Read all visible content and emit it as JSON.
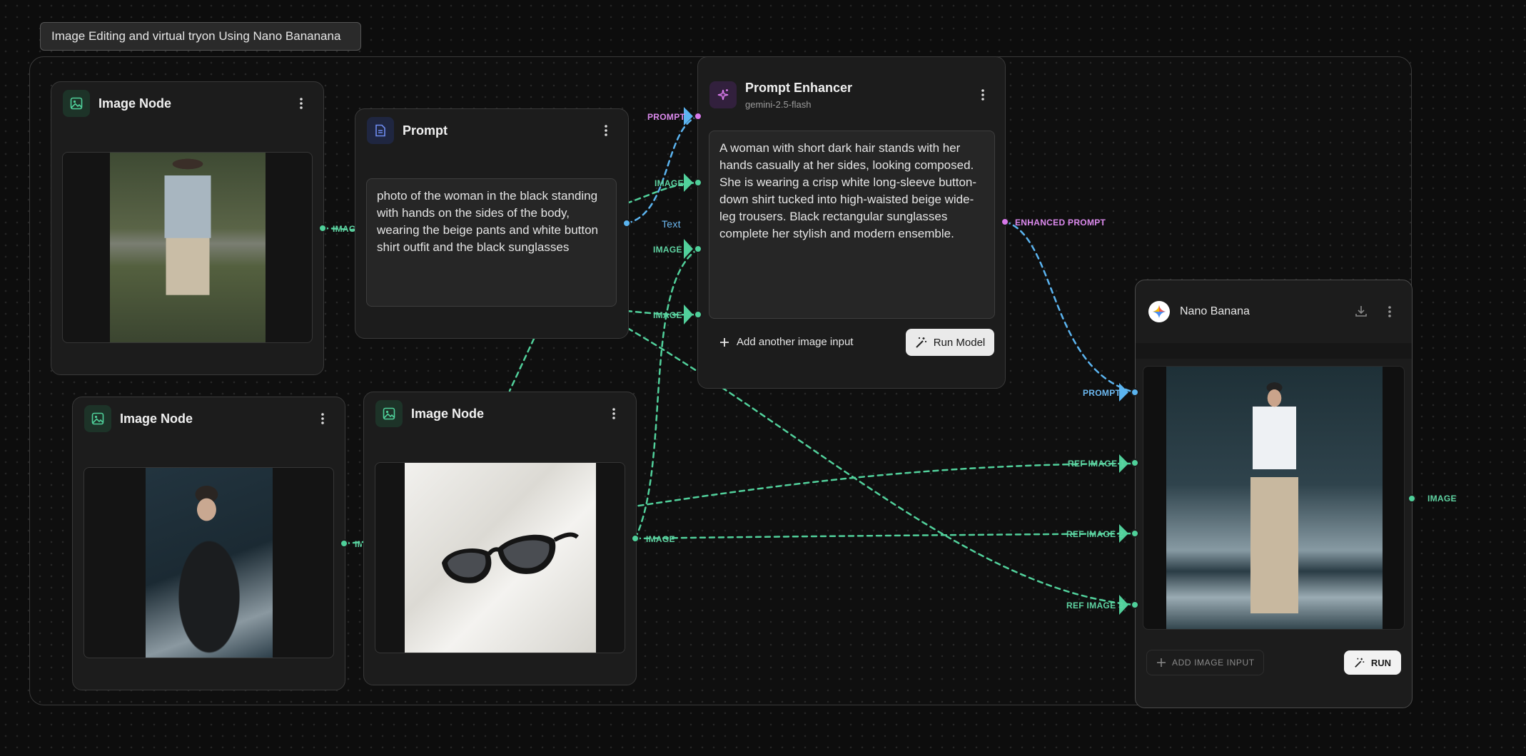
{
  "group": {
    "title": "Image Editing and virtual tryon Using Nano Bananana"
  },
  "image_node_1": {
    "title": "Image Node",
    "output_label": "IMAGE"
  },
  "image_node_2": {
    "title": "Image Node",
    "output_label": "IMAGE"
  },
  "image_node_3": {
    "title": "Image Node",
    "output_label": "IMAGE"
  },
  "prompt_node": {
    "title": "Prompt",
    "text": "photo of the woman in the black standing with hands on the sides of the body, wearing the beige pants and white button shirt outfit and the black sunglasses",
    "output_label": "Text"
  },
  "prompt_enhancer": {
    "title": "Prompt Enhancer",
    "model": "gemini-2.5-flash",
    "inputs": [
      "PROMPT",
      "IMAGE",
      "IMAGE",
      "IMAGE"
    ],
    "output_text": "A woman with short dark hair stands with her hands casually at her sides, looking composed. She is wearing a crisp white long-sleeve button-down shirt tucked into high-waisted beige wide-leg trousers. Black rectangular sunglasses complete her stylish and modern ensemble.",
    "add_input_label": "Add another image input",
    "run_label": "Run Model",
    "output_label": "ENHANCED PROMPT"
  },
  "nano_banana": {
    "title": "Nano Banana",
    "inputs": [
      "PROMPT",
      "REF IMAGE 1",
      "REF IMAGE 2",
      "REF IMAGE 3"
    ],
    "add_input_label": "ADD IMAGE INPUT",
    "run_label": "RUN",
    "output_label": "IMAGE"
  },
  "colors": {
    "image_port": "#4fd09a",
    "text_port": "#5ab4f0",
    "enhanced_port": "#d779ea",
    "wire_image": "#4fd09a",
    "wire_text": "#5ab4f0"
  }
}
